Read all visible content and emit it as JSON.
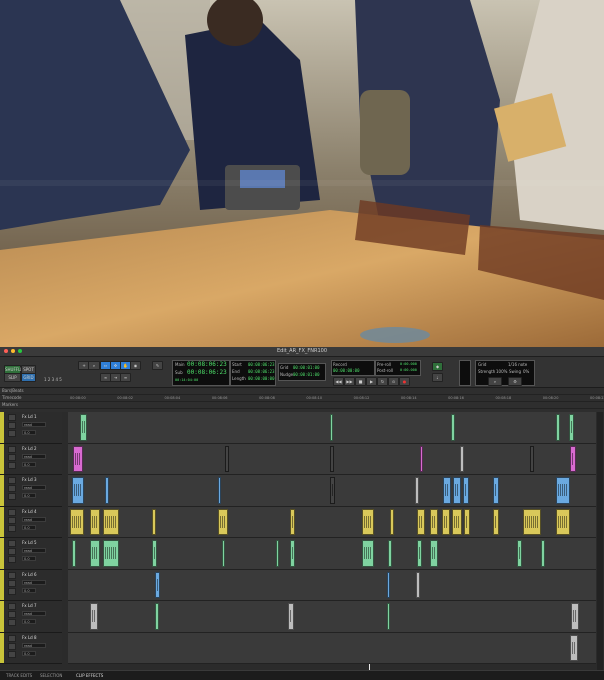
{
  "window": {
    "title": "Edit_AR_FX_FNR100",
    "colors": {
      "close": "#ff5f57",
      "minimize": "#febc2e",
      "maximize": "#28c840",
      "accent": "#2f7fd8",
      "selected_track": "#c9c43a"
    }
  },
  "video_frame": {
    "icon": "video-frame"
  },
  "toolbar": {
    "mode_buttons": [
      "SHUFFLE",
      "SPOT",
      "SLIP",
      "GRID"
    ],
    "nudge_label": "1 2 3 4 5",
    "tool_icons": [
      "zoom-icon",
      "trim-icon",
      "selector-icon",
      "grabber-icon",
      "scrub-icon",
      "pencil-icon"
    ],
    "main_counter": {
      "label_main": "Main",
      "label_sub": "Sub",
      "main": "00:08:06:23",
      "sub": "00:08:06:23",
      "extra": "00:14:04:00"
    },
    "selection": {
      "start_label": "Start",
      "end_label": "End",
      "length_label": "Length",
      "start": "00:08:06:23",
      "end": "00:08:06:23",
      "length": "00:00:00:00"
    },
    "grid": {
      "grid_label": "Grid",
      "nudge_label": "Nudge",
      "grid": "00:00:01:00",
      "nudge": "00:00:01:00"
    },
    "cue": {
      "label": "Record",
      "value": "00:00:00:00"
    },
    "transport_icons": [
      "rewind-icon",
      "fastforward-icon",
      "stop-icon",
      "play-icon",
      "record-icon",
      "loop-icon",
      "online-icon"
    ],
    "pre_post": {
      "pre_label": "Pre-roll",
      "post_label": "Post-roll",
      "pre": "0:00.000",
      "post": "0:00.000"
    },
    "right_panel": {
      "grid_label": "Grid",
      "grid_value": "1/16 note",
      "strength_label": "Strength",
      "strength": "100%",
      "swing_label": "Swing",
      "swing": "0%"
    }
  },
  "ruler": {
    "rows": [
      "Bars|Beats",
      "Timecode",
      "Markers"
    ],
    "ticks": [
      "00:08:00",
      "00:08:02",
      "00:08:04",
      "00:08:06",
      "00:08:08",
      "00:08:10",
      "00:08:12",
      "00:08:14",
      "00:08:16",
      "00:08:18",
      "00:08:20",
      "00:08:22"
    ]
  },
  "tracks": [
    {
      "name": "Fx Ld 1",
      "mode": "read",
      "volume": "0.0"
    },
    {
      "name": "Fx Ld 2",
      "mode": "read",
      "volume": "0.0"
    },
    {
      "name": "Fx Ld 3",
      "mode": "read",
      "volume": "0.0"
    },
    {
      "name": "Fx Ld 4",
      "mode": "read",
      "volume": "0.0"
    },
    {
      "name": "Fx Ld 5",
      "mode": "read",
      "volume": "0.0"
    },
    {
      "name": "Fx Ld 6",
      "mode": "read",
      "volume": "0.0"
    },
    {
      "name": "Fx Ld 7",
      "mode": "read",
      "volume": "0.0"
    },
    {
      "name": "Fx Ld 8",
      "mode": "read",
      "volume": "0.0"
    }
  ],
  "statusbar": {
    "tabs": [
      "TRACK EDITS",
      "SELECTION",
      "CLIP EFFECTS"
    ]
  }
}
